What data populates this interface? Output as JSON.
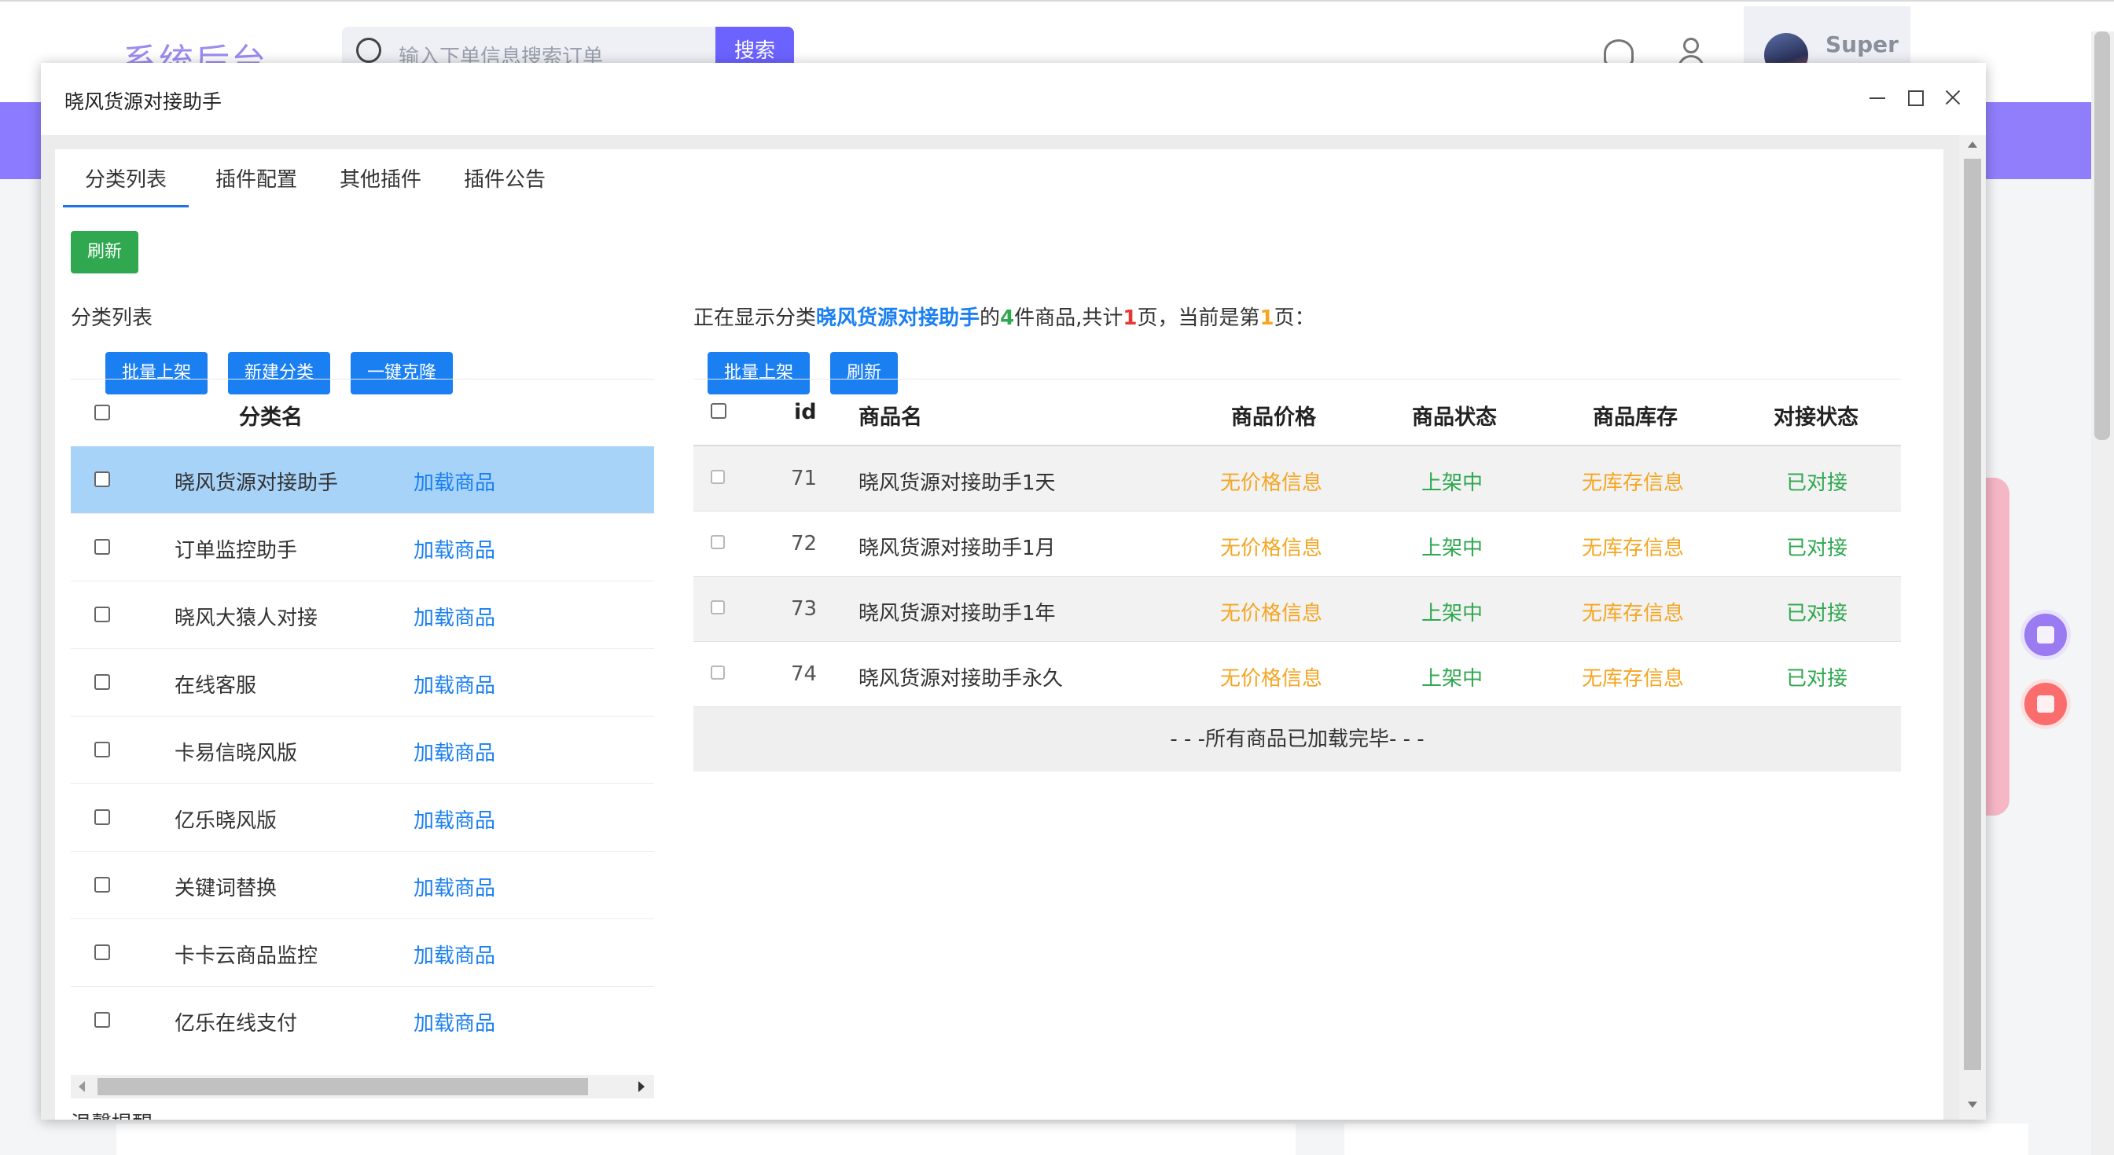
{
  "background": {
    "brand": "系统后台",
    "search_placeholder": "输入下单信息搜索订单",
    "search_button": "搜索",
    "user_name": "Super"
  },
  "dialog": {
    "title": "晓风货源对接助手",
    "tabs": [
      {
        "label": "分类列表",
        "active": true
      },
      {
        "label": "插件配置",
        "active": false
      },
      {
        "label": "其他插件",
        "active": false
      },
      {
        "label": "插件公告",
        "active": false
      }
    ],
    "refresh_button": "刷新",
    "left": {
      "section_label": "分类列表",
      "buttons": {
        "batch_up": "批量上架",
        "new_category": "新建分类",
        "one_click_clone": "一键克隆"
      },
      "header": {
        "name": "分类名"
      },
      "load_label": "加载商品",
      "rows": [
        {
          "name": "晓风货源对接助手",
          "selected": true
        },
        {
          "name": "订单监控助手",
          "selected": false
        },
        {
          "name": "晓风大猿人对接",
          "selected": false
        },
        {
          "name": "在线客服",
          "selected": false
        },
        {
          "name": "卡易信晓风版",
          "selected": false
        },
        {
          "name": "亿乐晓风版",
          "selected": false
        },
        {
          "name": "关键词替换",
          "selected": false
        },
        {
          "name": "卡卡云商品监控",
          "selected": false
        },
        {
          "name": "亿乐在线支付",
          "selected": false
        }
      ],
      "bottom_text": "温馨提醒"
    },
    "right": {
      "info": {
        "prefix": "正在显示分类",
        "category": "晓风货源对接助手",
        "mid1": "的",
        "count": "4",
        "mid2": "件商品,共计",
        "pages": "1",
        "mid3": "页，当前是第",
        "current": "1",
        "suffix": "页："
      },
      "buttons": {
        "batch_up": "批量上架",
        "refresh": "刷新"
      },
      "header": {
        "id": "id",
        "name": "商品名",
        "price": "商品价格",
        "state": "商品状态",
        "stock": "商品库存",
        "link": "对接状态"
      },
      "rows": [
        {
          "id": "71",
          "name": "晓风货源对接助手1天",
          "price": "无价格信息",
          "state": "上架中",
          "stock": "无库存信息",
          "link": "已对接"
        },
        {
          "id": "72",
          "name": "晓风货源对接助手1月",
          "price": "无价格信息",
          "state": "上架中",
          "stock": "无库存信息",
          "link": "已对接"
        },
        {
          "id": "73",
          "name": "晓风货源对接助手1年",
          "price": "无价格信息",
          "state": "上架中",
          "stock": "无库存信息",
          "link": "已对接"
        },
        {
          "id": "74",
          "name": "晓风货源对接助手永久",
          "price": "无价格信息",
          "state": "上架中",
          "stock": "无库存信息",
          "link": "已对接"
        }
      ],
      "footer": "- - -所有商品已加载完毕- - -"
    }
  },
  "colors": {
    "accent": "#1a7ff1",
    "green": "#2fa84f",
    "orange": "#f5a623",
    "selected_row": "#a7d3f9",
    "banner": "#8d7bff"
  }
}
